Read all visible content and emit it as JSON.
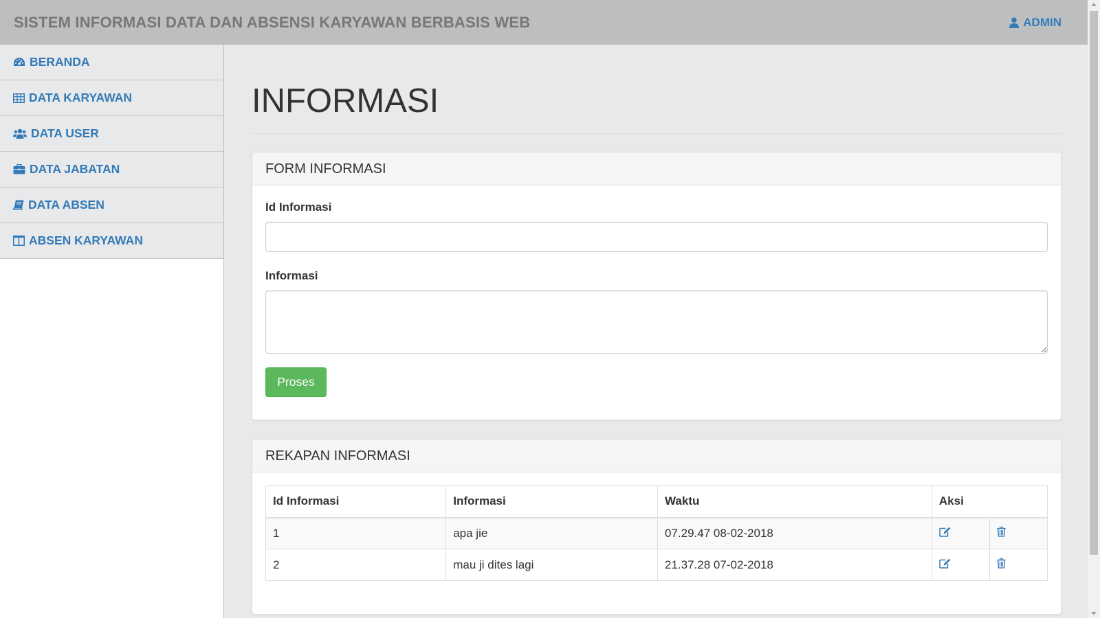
{
  "header": {
    "title": "SISTEM INFORMASI DATA DAN ABSENSI KARYAWAN BERBASIS WEB",
    "user_label": "ADMIN",
    "user_icon": "user-icon"
  },
  "sidebar": {
    "items": [
      {
        "label": "BERANDA",
        "icon": "dashboard-icon"
      },
      {
        "label": "DATA KARYAWAN",
        "icon": "table-icon"
      },
      {
        "label": "DATA USER",
        "icon": "users-icon"
      },
      {
        "label": "DATA JABATAN",
        "icon": "briefcase-icon"
      },
      {
        "label": "DATA ABSEN",
        "icon": "book-icon"
      },
      {
        "label": "ABSEN KARYAWAN",
        "icon": "columns-icon"
      }
    ]
  },
  "main": {
    "page_title": "INFORMASI",
    "form_panel": {
      "heading": "FORM INFORMASI",
      "id_label": "Id Informasi",
      "id_value": "",
      "info_label": "Informasi",
      "info_value": "",
      "submit_label": "Proses"
    },
    "table_panel": {
      "heading": "REKAPAN INFORMASI",
      "columns": [
        "Id Informasi",
        "Informasi",
        "Waktu",
        "Aksi"
      ],
      "rows": [
        {
          "id": "1",
          "informasi": "apa jie",
          "waktu": "07.29.47 08-02-2018"
        },
        {
          "id": "2",
          "informasi": "mau ji dites lagi",
          "waktu": "21.37.28 07-02-2018"
        }
      ]
    }
  },
  "colors": {
    "topbar": "#bdbec0",
    "link": "#337ab7",
    "success": "#5cb85c",
    "content_bg": "#e8e9eb"
  }
}
